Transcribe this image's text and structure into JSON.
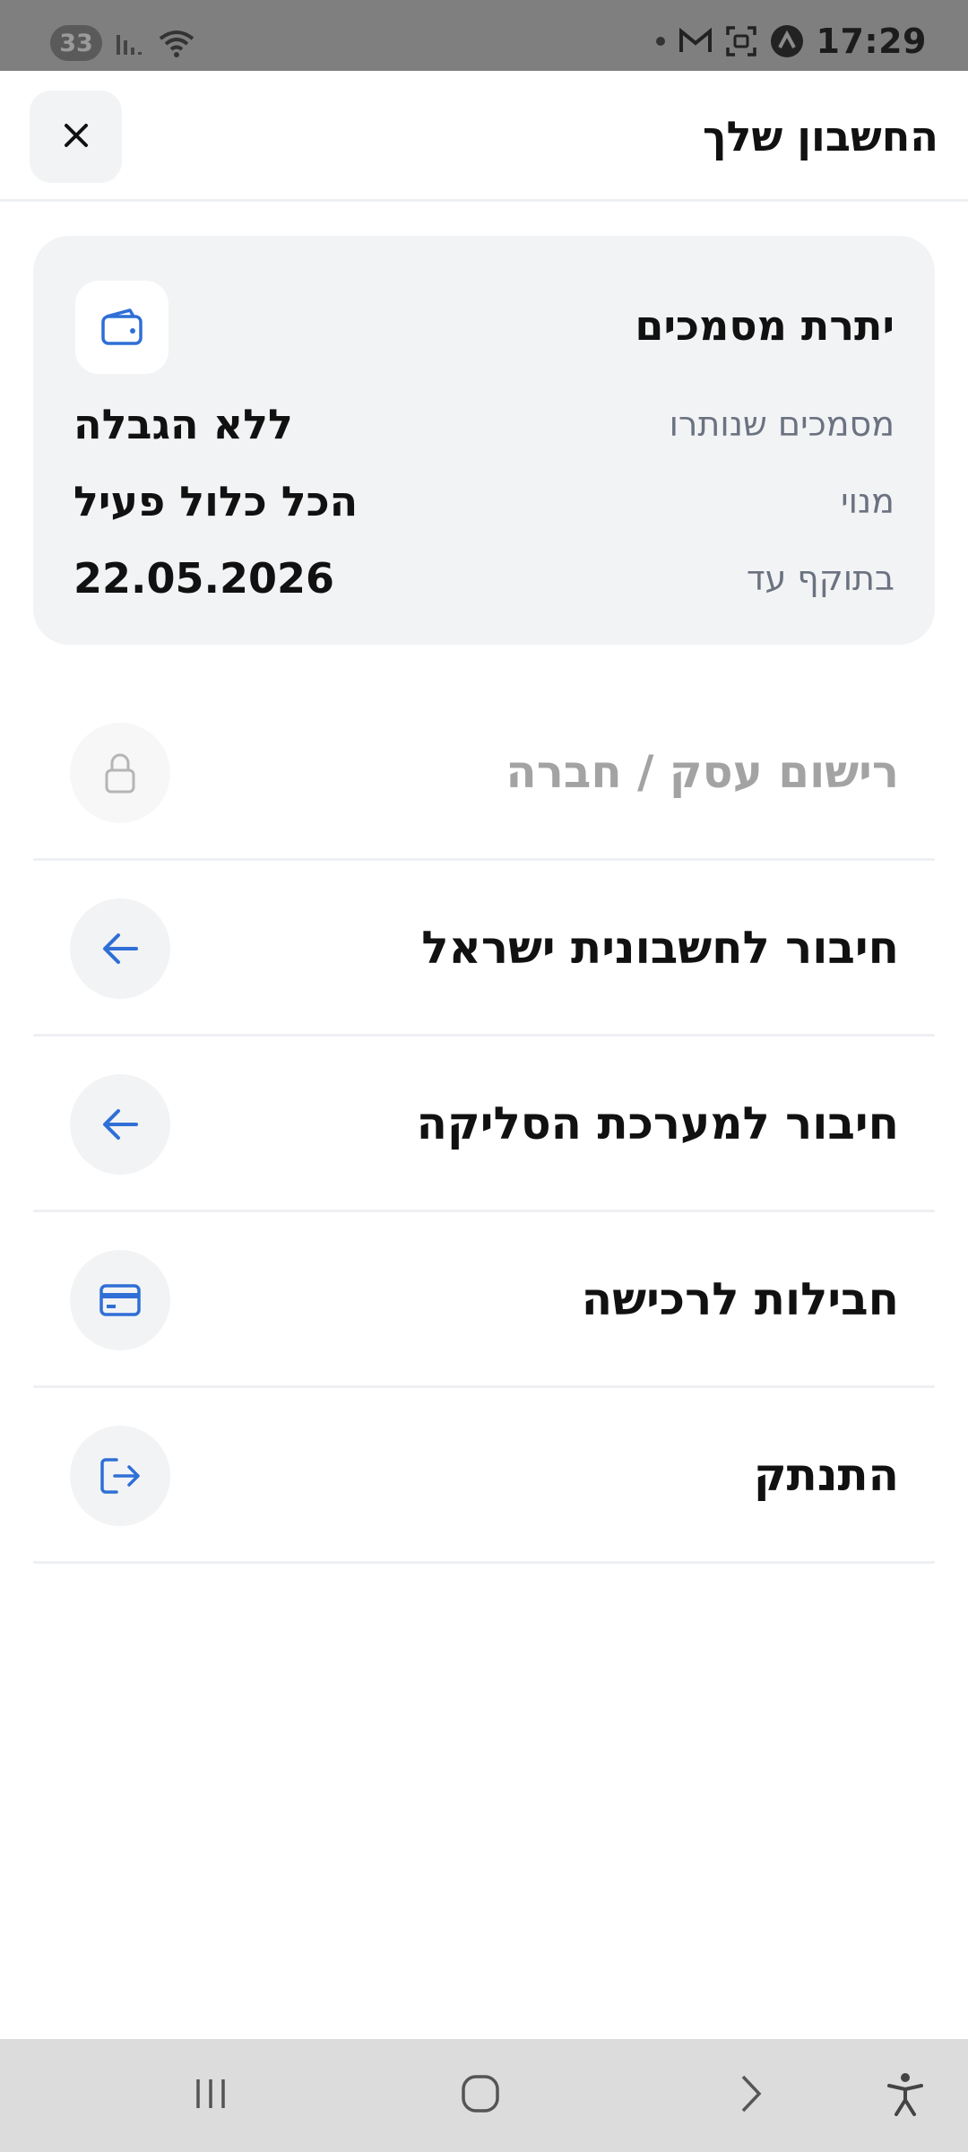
{
  "status_bar": {
    "badge": "33",
    "time": "17:29"
  },
  "header": {
    "title": "החשבון שלך"
  },
  "card": {
    "title": "יתרת מסמכים",
    "rows": [
      {
        "label": "מסמכים שנותרו",
        "value": "ללא הגבלה"
      },
      {
        "label": "מנוי",
        "value": "הכל כלול פעיל"
      },
      {
        "label": "בתוקף עד",
        "value": "22.05.2026"
      }
    ]
  },
  "menu": {
    "items": [
      {
        "label": "רישום עסק / חברה",
        "icon": "lock-icon",
        "disabled": true
      },
      {
        "label": "חיבור לחשבונית ישראל",
        "icon": "arrow-left-icon"
      },
      {
        "label": "חיבור למערכת הסליקה",
        "icon": "arrow-left-icon"
      },
      {
        "label": "חבילות לרכישה",
        "icon": "credit-card-icon"
      },
      {
        "label": "התנתק",
        "icon": "logout-icon"
      }
    ]
  },
  "colors": {
    "accent": "#2f6fd6",
    "card_bg": "#f2f3f5",
    "muted_text": "#6b7280",
    "disabled_text": "#a3a3a3"
  }
}
